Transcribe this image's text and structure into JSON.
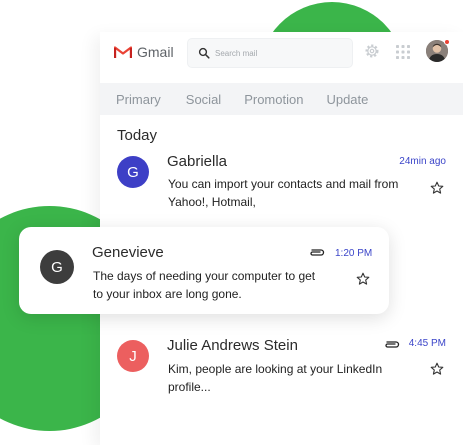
{
  "app": {
    "logo_text": "Gmail",
    "logo_icon": "gmail-m-icon"
  },
  "colors": {
    "brand_green": "#3bb54a",
    "gmail_red": "#ea4335",
    "time_blue": "#3b45c9",
    "avatar_purple": "#3d3fc6",
    "avatar_dark": "#3d3d3d",
    "avatar_red": "#ec5f5f",
    "tab_bar": "#f3f4f6"
  },
  "header": {
    "search_placeholder": "Search mail",
    "icons": [
      "search-icon",
      "gear-icon",
      "apps-grid-icon",
      "user-avatar"
    ]
  },
  "tabs": [
    {
      "label": "Primary"
    },
    {
      "label": "Social"
    },
    {
      "label": "Promotion"
    },
    {
      "label": "Update"
    }
  ],
  "section": {
    "heading": "Today"
  },
  "emails": [
    {
      "initial": "G",
      "sender": "Gabriella",
      "time": "24min ago",
      "snippet_line1": "You can import your contacts and mail from",
      "snippet_line2": "Yahoo!, Hotmail,",
      "has_attachment": false
    },
    {
      "initial": "G",
      "sender": "Genevieve",
      "time": "1:20 PM",
      "snippet_line1": "The days of needing your computer to get",
      "snippet_line2": "to your inbox are long gone.",
      "has_attachment": true
    },
    {
      "initial": "J",
      "sender": "Julie Andrews Stein",
      "time": "4:45 PM",
      "snippet_line1": "Kim, people are looking at your LinkedIn",
      "snippet_line2": "profile...",
      "has_attachment": true
    }
  ]
}
